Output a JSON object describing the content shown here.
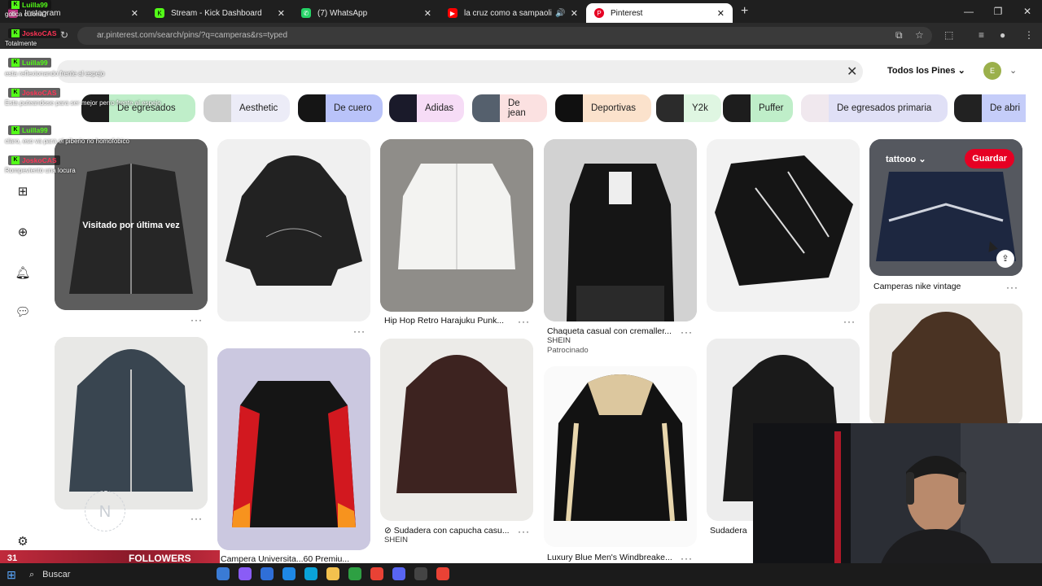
{
  "browser": {
    "tabs": [
      {
        "title": "Instagram",
        "color": "#c13584",
        "icon": "instagram-icon",
        "active": false
      },
      {
        "title": "Stream - Kick Dashboard",
        "color": "#53fc18",
        "icon": "kick-icon",
        "active": false
      },
      {
        "title": "(7) WhatsApp",
        "color": "#25d366",
        "icon": "whatsapp-icon",
        "active": false
      },
      {
        "title": "la cruz como a sampaoli | Y",
        "color": "#ff0000",
        "icon": "youtube-icon",
        "active": false
      },
      {
        "title": "Pinterest",
        "color": "#e60023",
        "icon": "pinterest-icon",
        "active": true
      }
    ],
    "url": "ar.pinterest.com/search/pins/?q=camperas&rs=typed"
  },
  "header": {
    "filter_label": "Todos los Pines",
    "avatar_letter": "E"
  },
  "chips": [
    {
      "label": "De egresados",
      "bg": "#bfeec9"
    },
    {
      "label": "Aesthetic",
      "bg": "#ececf7"
    },
    {
      "label": "De cuero",
      "bg": "#b9c3f9"
    },
    {
      "label": "Adidas",
      "bg": "#f6dcf6"
    },
    {
      "label": "De jean",
      "bg": "#fbe1e1"
    },
    {
      "label": "Deportivas",
      "bg": "#fbe2cc"
    },
    {
      "label": "Y2k",
      "bg": "#dff6e2"
    },
    {
      "label": "Puffer",
      "bg": "#bfeec9"
    },
    {
      "label": "De egresados primaria",
      "bg": "#e0e0f6"
    },
    {
      "label": "De abri",
      "bg": "#c5cdf9"
    }
  ],
  "pins": {
    "p1": {
      "overlay": "Visitado por última vez"
    },
    "p3": {
      "caption": "Hip Hop Retro Harajuku Punk..."
    },
    "p4": {
      "caption": "Chaqueta casual con cremaller...",
      "source": "SHEIN",
      "sponsored": "Patrocinado"
    },
    "p6": {
      "board": "tattooo",
      "save": "Guardar",
      "caption": "Camperas nike vintage"
    },
    "p8": {
      "caption": "Campera Universita...60 Premiu..."
    },
    "p9": {
      "caption": "Sudadera con capucha casu...",
      "source": "SHEIN"
    },
    "p10": {
      "caption": "Luxury Blue Men's Windbreake..."
    },
    "p11": {
      "caption": "Sudadera"
    }
  },
  "taskbar": {
    "search": "Buscar"
  },
  "overlay": {
    "chat": [
      {
        "user": "Luilla99",
        "msg": "gotica culona?",
        "red": false
      },
      {
        "user": "JoskoCAS",
        "msg": "Totalmente",
        "red": true
      },
      {
        "user": "Luilla99",
        "msg": "esta reflexionando frente al espejo",
        "red": false
      },
      {
        "user": "JoskoCAS",
        "msg": "Esta puteandose para ser mejor perro frente al espejo",
        "red": true
      },
      {
        "user": "Luilla99",
        "msg": "claro, eso va para el piberio no homofobico",
        "red": false
      },
      {
        "user": "JoskoCAS",
        "msg": "Rompeviento una locura",
        "red": true
      }
    ],
    "followers_count": "31",
    "followers_label": "FOLLOWERS"
  }
}
